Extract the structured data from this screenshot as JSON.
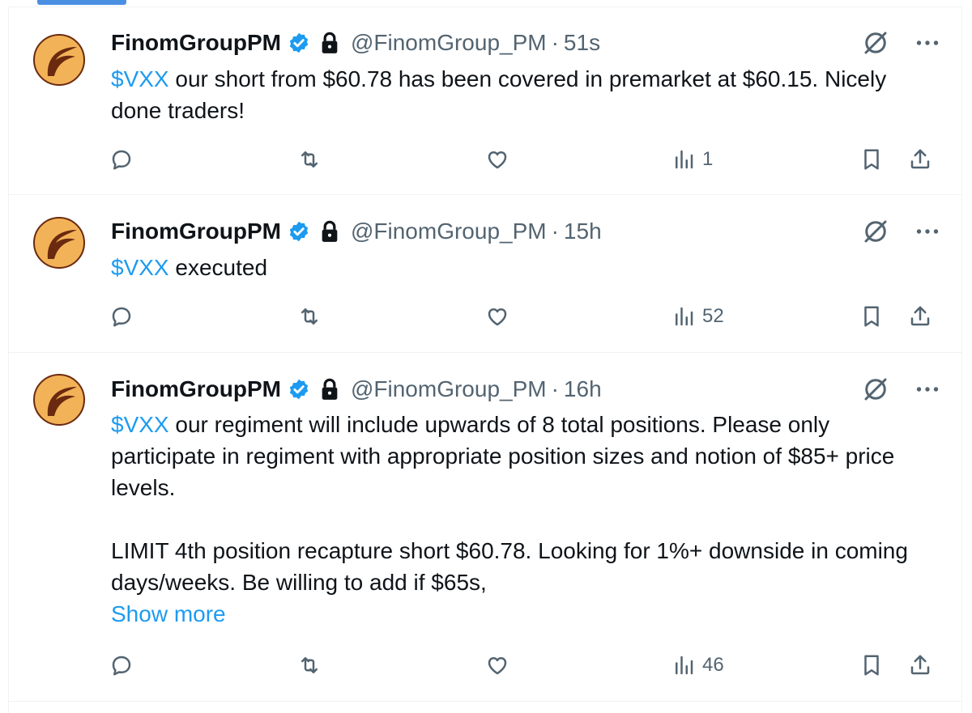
{
  "tweets": [
    {
      "display_name": "FinomGroupPM",
      "handle": "@FinomGroup_PM",
      "separator": "·",
      "time": "51s",
      "cashtag": "$VXX",
      "text": " our short from $60.78 has been covered in premarket at $60.15. Nicely done traders!",
      "views": "1"
    },
    {
      "display_name": "FinomGroupPM",
      "handle": "@FinomGroup_PM",
      "separator": "·",
      "time": "15h",
      "cashtag": "$VXX",
      "text": " executed",
      "views": "52"
    },
    {
      "display_name": "FinomGroupPM",
      "handle": "@FinomGroup_PM",
      "separator": "·",
      "time": "16h",
      "cashtag": "$VXX",
      "text": " our regiment will include upwards of 8 total positions. Please only participate in regiment with appropriate position sizes and notion of $85+ price levels.",
      "text2": "LIMIT 4th position recapture short $60.78. Looking for 1%+ downside in coming days/weeks. Be willing to add if $65s,",
      "show_more": "Show more",
      "views": "46"
    }
  ],
  "colors": {
    "link": "#1d9bf0",
    "secondary_text": "#536471",
    "verified_badge": "#1d9bf0",
    "avatar_fill": "#f2b257",
    "avatar_stroke": "#6b2a0f"
  },
  "icons": [
    "verified-badge-icon",
    "lock-icon",
    "grok-icon",
    "more-icon",
    "reply-icon",
    "retweet-icon",
    "like-icon",
    "views-icon",
    "bookmark-icon",
    "share-icon"
  ]
}
